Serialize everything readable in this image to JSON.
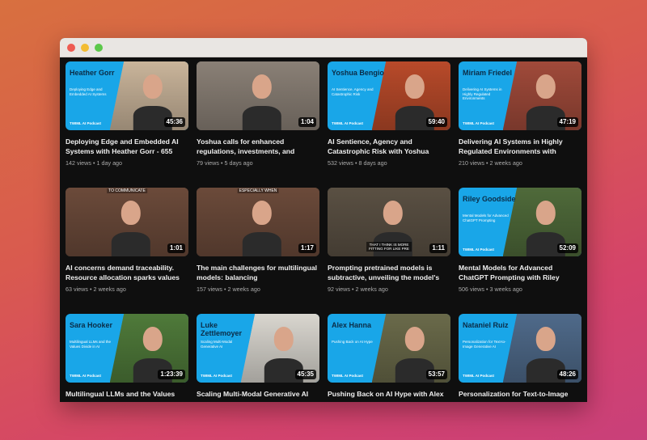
{
  "window": {
    "controls": [
      "close",
      "minimize",
      "zoom"
    ]
  },
  "videos": [
    {
      "title": "Deploying Edge and Embedded AI Systems with Heather Gorr - 655",
      "views": "142 views",
      "age": "1 day ago",
      "duration": "45:36",
      "style": "podcast",
      "guest_name": "Heather Gorr",
      "topic": "Deploying Edge and Embedded AI Systems",
      "brand": "TWIML AI Podcast",
      "photo_color": "#c9b49a"
    },
    {
      "title": "Yoshua calls for enhanced regulations, investments, and",
      "views": "79 views",
      "age": "5 days ago",
      "duration": "1:04",
      "style": "short",
      "photo_color": "#8a8076"
    },
    {
      "title": "AI Sentience, Agency and Catastrophic Risk with Yoshua",
      "views": "532 views",
      "age": "8 days ago",
      "duration": "59:40",
      "style": "podcast",
      "guest_name": "Yoshua Bengio",
      "topic": "AI Sentience, Agency and Catastrophic Risk",
      "brand": "TWIML AI Podcast",
      "photo_color": "#b84a2a"
    },
    {
      "title": "Delivering AI Systems in Highly Regulated Environments with",
      "views": "210 views",
      "age": "2 weeks ago",
      "duration": "47:19",
      "style": "podcast",
      "guest_name": "Miriam Friedel",
      "topic": "Delivering AI Systems in Highly Regulated Environments",
      "brand": "TWIML AI Podcast",
      "photo_color": "#a04a3a"
    },
    {
      "title": "AI concerns demand traceability. Resource allocation sparks values",
      "views": "63 views",
      "age": "2 weeks ago",
      "duration": "1:01",
      "style": "short",
      "caption_top": "TO COMMUNICATE",
      "photo_color": "#6b4a3a"
    },
    {
      "title": "The main challenges for multilingual models: balancing",
      "views": "157 views",
      "age": "2 weeks ago",
      "duration": "1:17",
      "style": "short",
      "caption_top": "ESPECIALLY WHEN",
      "photo_color": "#6b4a3a"
    },
    {
      "title": "Prompting pretrained models is subtractive, unveiling the model's",
      "views": "92 views",
      "age": "2 weeks ago",
      "duration": "1:11",
      "style": "short",
      "caption_bottom": "THAT I THINK IS MORE FITTING FOR LIKE PRE",
      "photo_color": "#5a5043"
    },
    {
      "title": "Mental Models for Advanced ChatGPT Prompting with Riley",
      "views": "506 views",
      "age": "3 weeks ago",
      "duration": "52:09",
      "style": "podcast",
      "guest_name": "Riley Goodside",
      "topic": "Mental Models for Advanced ChatGPT Prompting",
      "brand": "TWIML AI Podcast",
      "photo_color": "#4f6a3a"
    },
    {
      "title": "Multilingual LLMs and the Values",
      "views": "",
      "age": "",
      "duration": "1:23:39",
      "style": "podcast",
      "guest_name": "Sara Hooker",
      "topic": "Multilingual LLMs and the Values Divide in AI",
      "brand": "TWIML AI Podcast",
      "photo_color": "#4f7a3a"
    },
    {
      "title": "Scaling Multi-Modal Generative AI",
      "views": "",
      "age": "",
      "duration": "45:35",
      "style": "podcast",
      "guest_name": "Luke Zettlemoyer",
      "topic": "Scaling Multi-Modal Generative AI",
      "brand": "TWIML AI Podcast",
      "photo_color": "#d9d6cf"
    },
    {
      "title": "Pushing Back on AI Hype with Alex",
      "views": "",
      "age": "",
      "duration": "53:57",
      "style": "podcast",
      "guest_name": "Alex Hanna",
      "topic": "Pushing Back on AI Hype",
      "brand": "TWIML AI Podcast",
      "photo_color": "#6a6a4a"
    },
    {
      "title": "Personalization for Text-to-Image",
      "views": "",
      "age": "",
      "duration": "48:26",
      "style": "podcast",
      "guest_name": "Nataniel Ruiz",
      "topic": "Personalization for Text-to-Image Generative AI",
      "brand": "TWIML AI Podcast",
      "photo_color": "#4f6a8a"
    }
  ]
}
